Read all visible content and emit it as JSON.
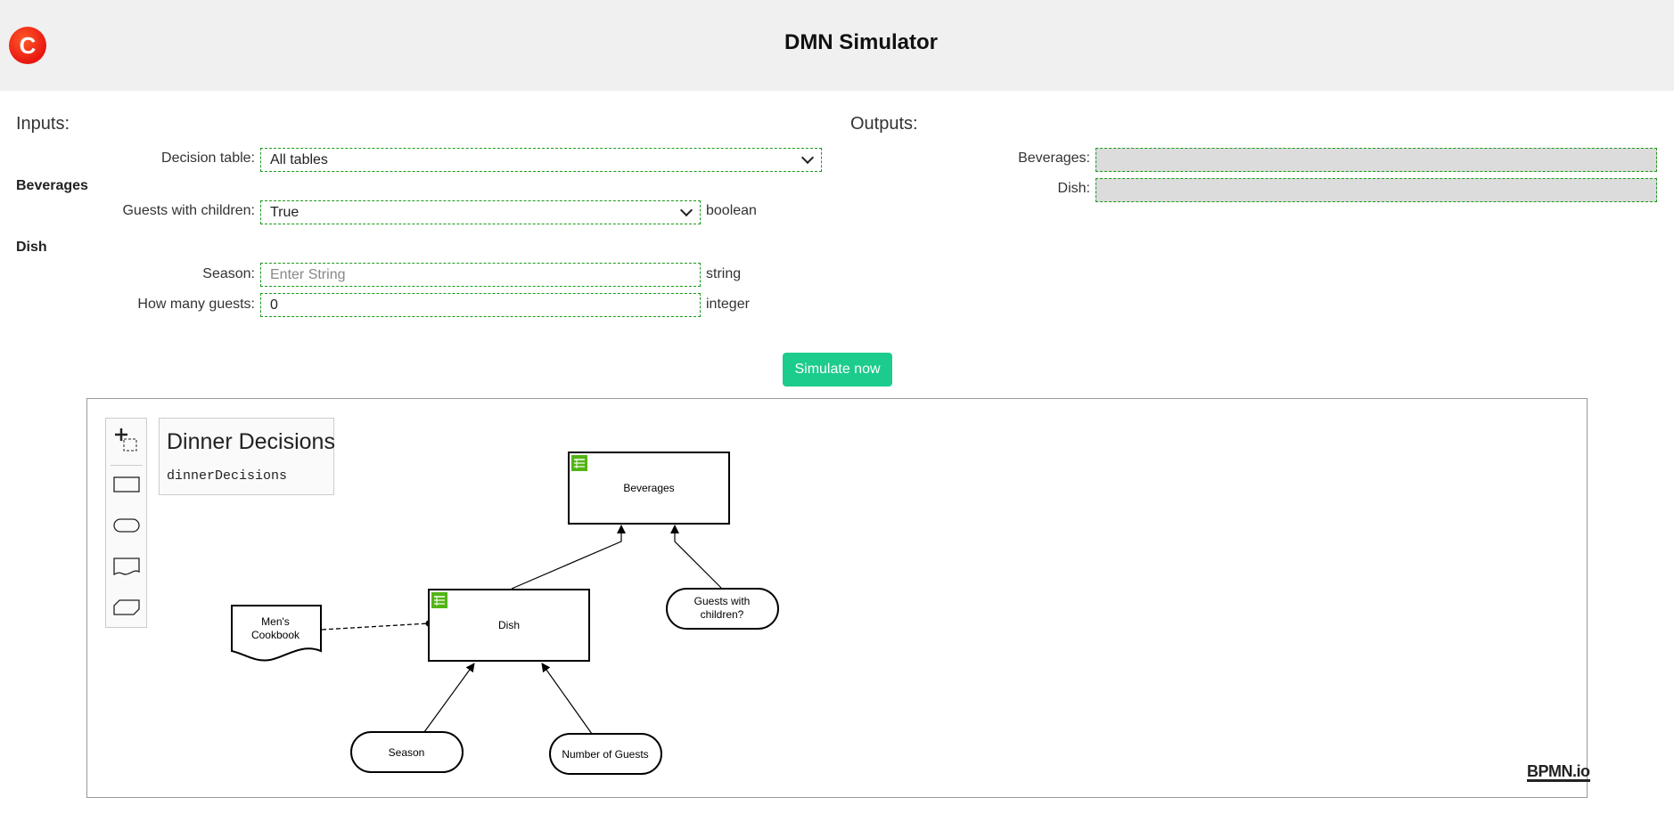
{
  "header": {
    "logo_glyph": "C",
    "title": "DMN Simulator"
  },
  "inputs": {
    "title": "Inputs:",
    "decision_table": {
      "label": "Decision table:",
      "value": "All tables"
    },
    "groups": [
      {
        "title": "Beverages",
        "fields": [
          {
            "label": "Guests with children:",
            "value": "True",
            "type": "boolean"
          }
        ]
      },
      {
        "title": "Dish",
        "fields": [
          {
            "label": "Season:",
            "value": "",
            "placeholder": "Enter String",
            "type": "string"
          },
          {
            "label": "How many guests:",
            "value": "0",
            "type": "integer"
          }
        ]
      }
    ]
  },
  "outputs": {
    "title": "Outputs:",
    "fields": [
      {
        "label": "Beverages:",
        "value": ""
      },
      {
        "label": "Dish:",
        "value": ""
      }
    ]
  },
  "actions": {
    "simulate_label": "Simulate now"
  },
  "diagram": {
    "definitions_name": "Dinner Decisions",
    "definitions_id": "dinnerDecisions",
    "nodes": {
      "beverages": "Beverages",
      "dish": "Dish",
      "guests_with_children": [
        "Guests with",
        "children?"
      ],
      "mens_cookbook": [
        "Men's",
        "Cookbook"
      ],
      "season": "Season",
      "number_of_guests": "Number of Guests"
    },
    "palette": [
      "lasso-tool-icon",
      "decision-icon",
      "input-data-icon",
      "knowledge-source-icon",
      "business-knowledge-model-icon"
    ],
    "watermark": "BPMN.io",
    "colors": {
      "table_badge": "#52b415",
      "accent_green": "#1ccc8c",
      "logo_red": "#e8160f"
    }
  }
}
